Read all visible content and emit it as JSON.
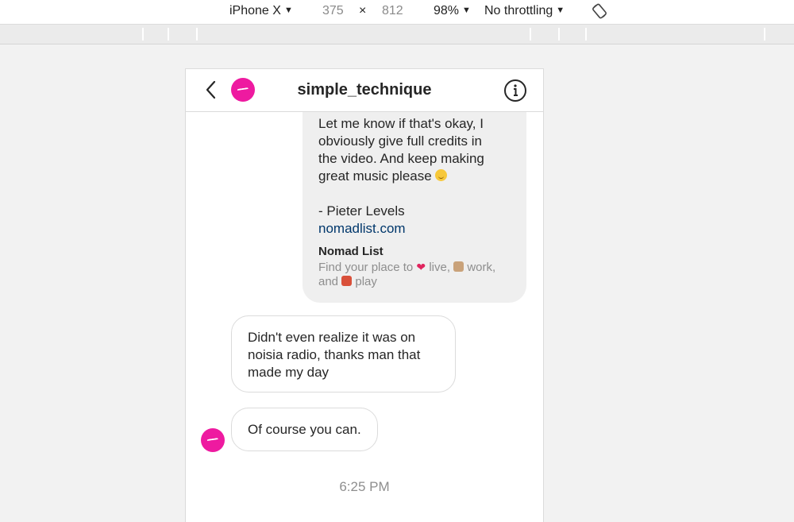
{
  "devtools": {
    "device": "iPhone X",
    "width": "375",
    "times": "×",
    "height": "812",
    "zoom": "98%",
    "throttling": "No throttling",
    "dropdown_glyph": "▼"
  },
  "chat": {
    "username": "simple_technique",
    "sent_message": {
      "lines": [
        "Let me know if that's okay, I",
        "obviously give full credits in",
        "the video. And keep making",
        "great music please"
      ],
      "signature": "- Pieter Levels",
      "link": "nomadlist.com",
      "preview_title": "Nomad List",
      "preview_desc_1": "Find your place to",
      "preview_desc_2": "live,",
      "preview_desc_3": "work,",
      "preview_desc_4": "and",
      "preview_desc_5": "play"
    },
    "received_messages": [
      {
        "lines": [
          "Didn't even realize it was on",
          "noisia radio, thanks man that",
          "made my day"
        ]
      },
      {
        "lines": [
          "Of course you can."
        ]
      }
    ],
    "timestamp": "6:25 PM"
  },
  "colors": {
    "avatar": "#ee1aa0",
    "link": "#00376b",
    "sent_bubble": "#efefef"
  },
  "icons": [
    "back-arrow-icon",
    "info-icon",
    "rotate-icon"
  ]
}
